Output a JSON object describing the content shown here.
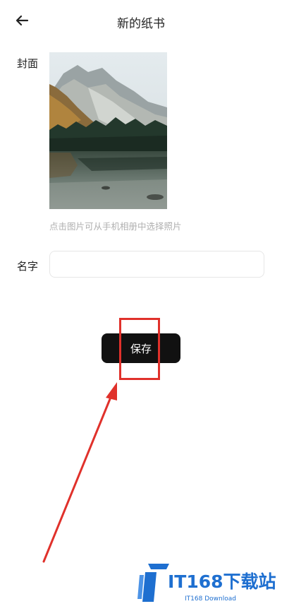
{
  "header": {
    "title": "新的纸书",
    "back_icon": "arrow-left-icon"
  },
  "form": {
    "cover_label": "封面",
    "cover_hint": "点击图片可从手机相册中选择照片",
    "name_label": "名字",
    "name_value": "",
    "name_placeholder": ""
  },
  "actions": {
    "save_label": "保存"
  },
  "annotations": {
    "highlight_color": "#e0312b"
  },
  "watermark": {
    "title": "IT168下载站",
    "subtitle": "IT168 Download",
    "color": "#1e6fd0"
  }
}
